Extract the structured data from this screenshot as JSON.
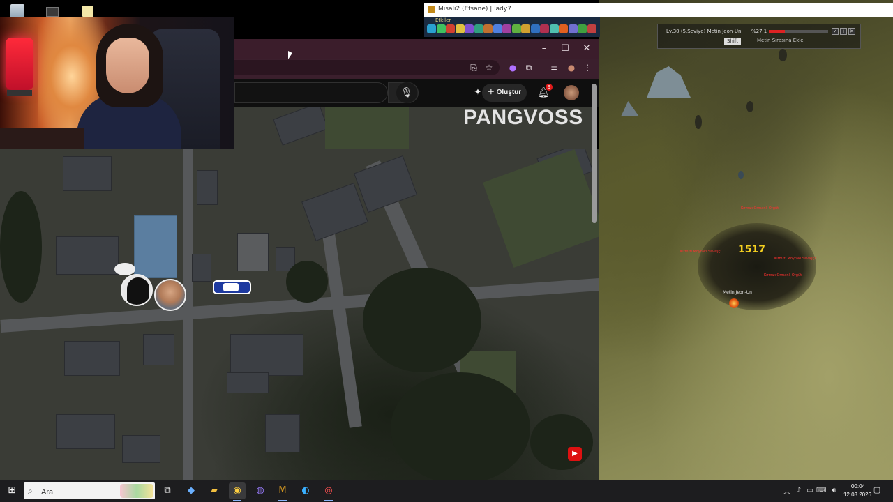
{
  "game_window": {
    "title": "Misali2 (Efsane) | lady7",
    "skillbar_label": "Etkiler",
    "target": {
      "name": "Lv.30 (5.Seviye) Metin Jeon-Un",
      "hp_text": "%27.1",
      "hp_fraction": 0.271,
      "shift_key": "Shift",
      "add_label": "Metin Sırasına Ekle"
    },
    "damage_text": "1517",
    "metin_label": "Metin Jeon-Un",
    "mob_labels": [
      "Kırmızı Ormanlı Örgüt",
      "Kırmızı Moyrakl Savaşçı",
      "Kırmızı Moyrakl Savaşçı",
      "Kırmızı Ormanlı Örgüt"
    ]
  },
  "browser": {
    "youtube": {
      "create_label": "Oluştur",
      "notification_count": "9"
    }
  },
  "stream_overlay": {
    "channel_title": "PANGVOSS"
  },
  "taskbar": {
    "search_placeholder": "Ara",
    "clock_time": "00:04",
    "clock_date": "12.03.2026"
  }
}
